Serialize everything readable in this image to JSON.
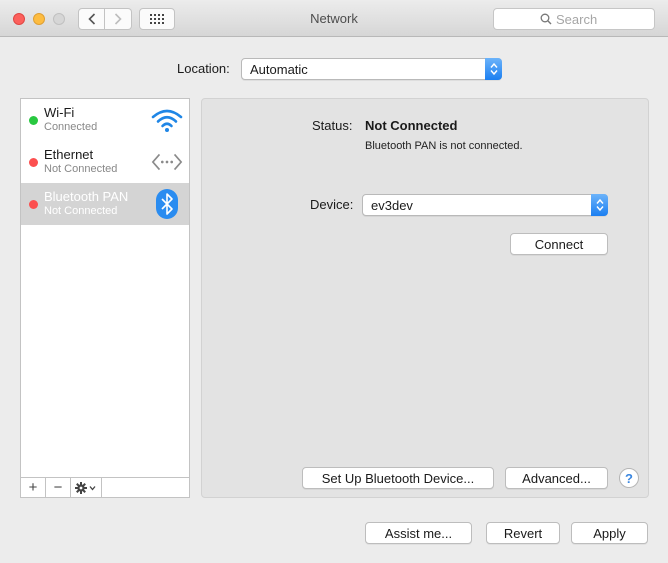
{
  "window": {
    "title": "Network",
    "search_placeholder": "Search"
  },
  "location": {
    "label": "Location:",
    "value": "Automatic"
  },
  "services": [
    {
      "name": "Wi-Fi",
      "status": "Connected",
      "status_color": "#28c840",
      "icon": "wifi-icon",
      "selected": false
    },
    {
      "name": "Ethernet",
      "status": "Not Connected",
      "status_color": "#fc4f4f",
      "icon": "ethernet-icon",
      "selected": false
    },
    {
      "name": "Bluetooth PAN",
      "status": "Not Connected",
      "status_color": "#fc4f4f",
      "icon": "bluetooth-icon",
      "selected": true
    }
  ],
  "sidebar_controls": {
    "add": "+",
    "remove": "−",
    "action": "gear-icon"
  },
  "detail": {
    "status_label": "Status:",
    "status_value": "Not Connected",
    "status_message": "Bluetooth PAN is not connected.",
    "device_label": "Device:",
    "device_value": "ev3dev",
    "connect_label": "Connect",
    "setup_label": "Set Up Bluetooth Device...",
    "advanced_label": "Advanced...",
    "help_label": "?"
  },
  "footer": {
    "assist_label": "Assist me...",
    "revert_label": "Revert",
    "apply_label": "Apply"
  },
  "colors": {
    "accent": "#1b7ff1",
    "selection": "#d4d4d4"
  }
}
